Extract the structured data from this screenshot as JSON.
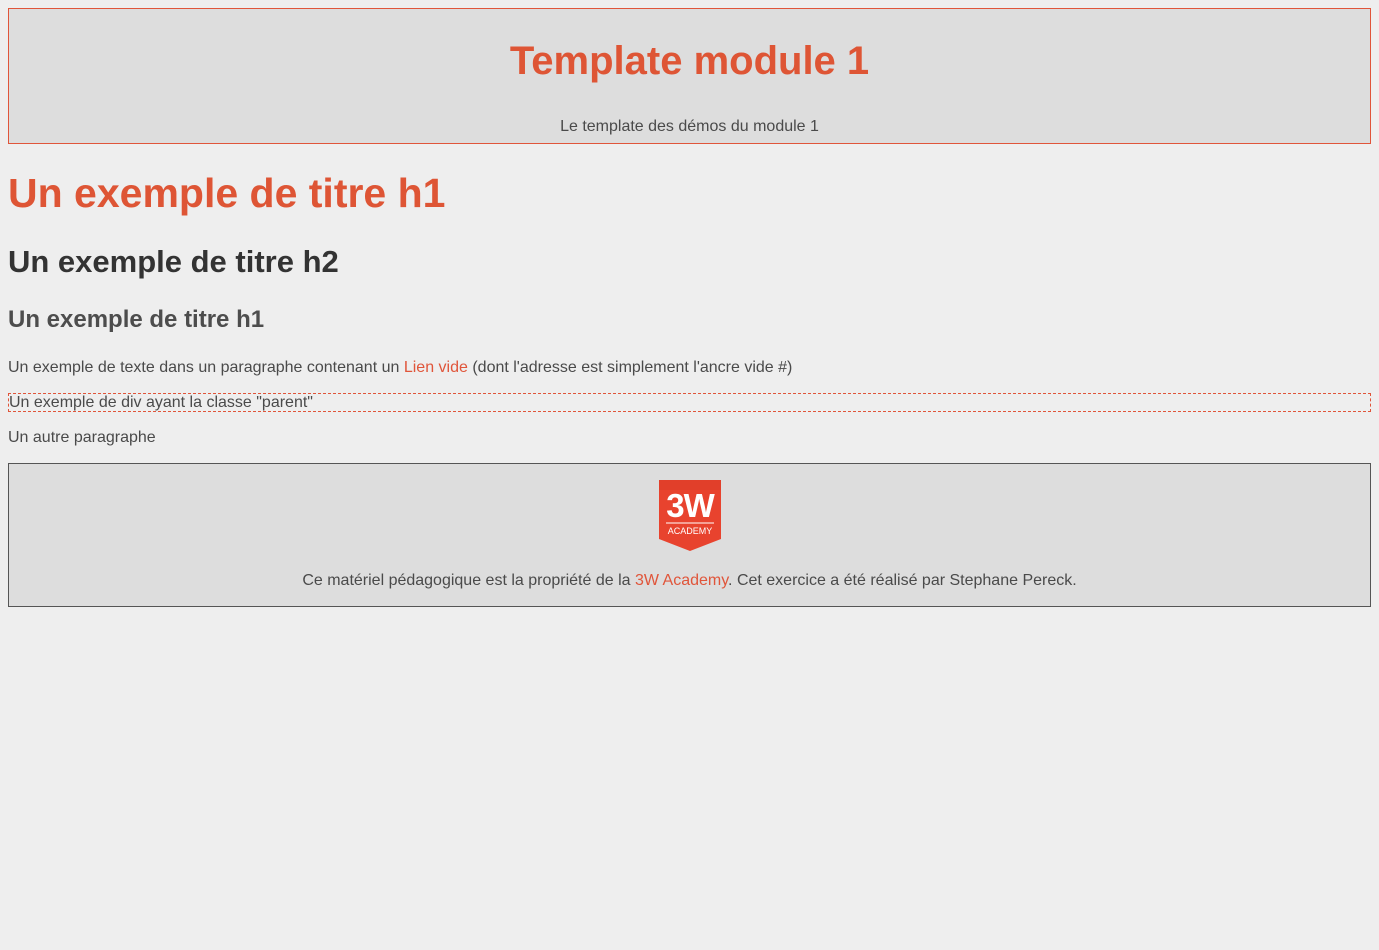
{
  "header": {
    "title": "Template module 1",
    "subtitle": "Le template des démos du module 1"
  },
  "content": {
    "h1": "Un exemple de titre h1",
    "h2": "Un exemple de titre h2",
    "h3": "Un exemple de titre h1",
    "paragraph1": {
      "before": "Un exemple de texte dans un paragraphe contenant un ",
      "link": "Lien vide",
      "after": " (dont l'adresse est simplement l'ancre vide #)"
    },
    "parent_div": "Un exemple de div ayant la classe \"parent\"",
    "paragraph2": "Un autre paragraphe"
  },
  "footer": {
    "logo": {
      "icon": "3w-academy-logo-icon",
      "line1": "3W",
      "line2": "ACADEMY"
    },
    "text_before": "Ce matériel pédagogique est la propriété de la ",
    "link": "3W Academy",
    "text_after": ". Cet exercice a été réalisé par Stephane Pereck."
  },
  "colors": {
    "accent": "#e0553a",
    "background": "#eeeeee",
    "panel": "#dddddd",
    "text": "#4a4a4a",
    "logo_red": "#e8432e"
  }
}
